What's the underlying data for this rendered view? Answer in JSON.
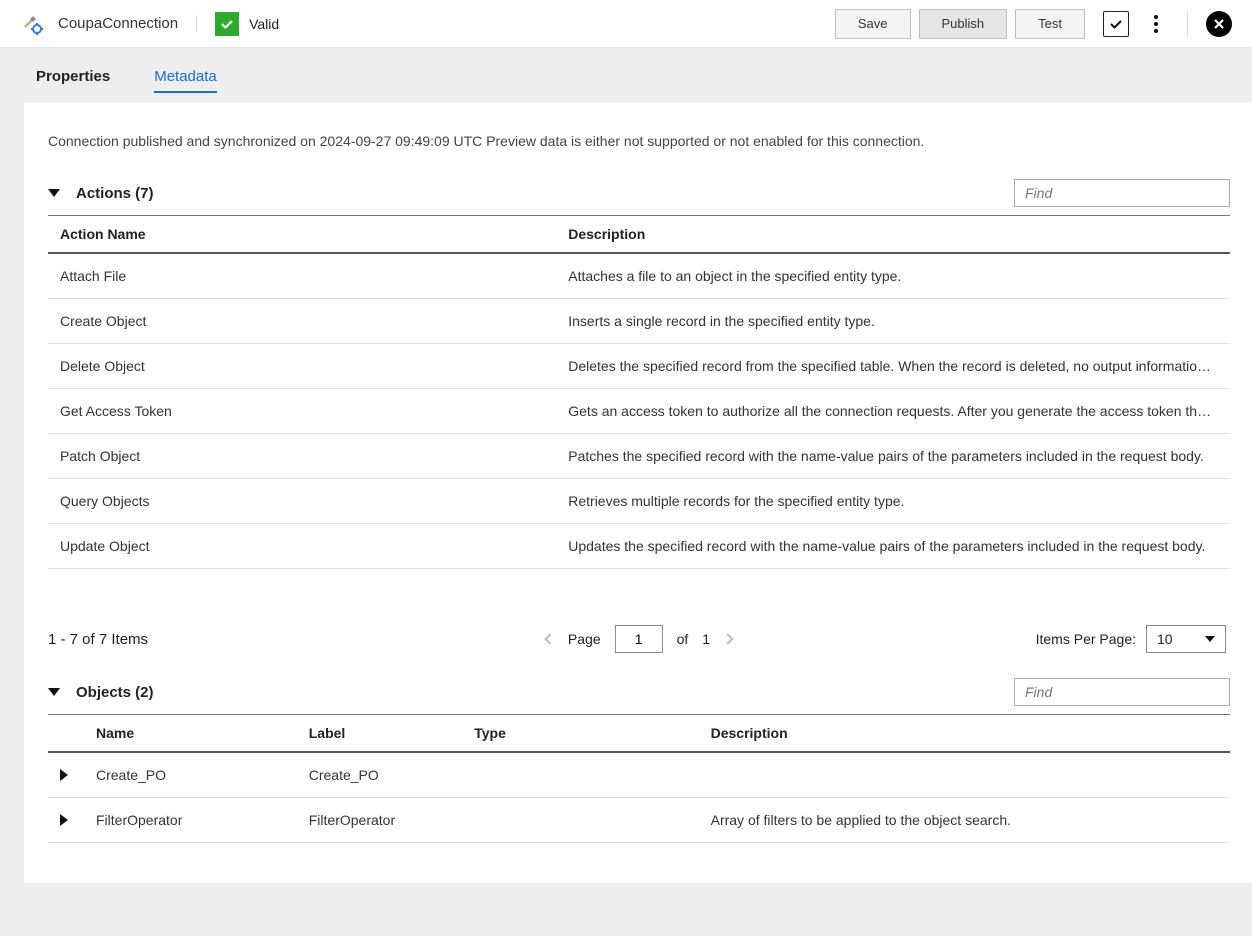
{
  "header": {
    "title": "CoupaConnection",
    "status_label": "Valid",
    "save_label": "Save",
    "publish_label": "Publish",
    "test_label": "Test"
  },
  "tabs": {
    "properties_label": "Properties",
    "metadata_label": "Metadata"
  },
  "status_text": "Connection published and synchronized on 2024-09-27 09:49:09 UTC Preview data is either not supported or not enabled for this connection.",
  "actions_section": {
    "title": "Actions (7)",
    "find_placeholder": "Find",
    "columns": {
      "name": "Action Name",
      "description": "Description"
    },
    "rows": [
      {
        "name": "Attach File",
        "description": "Attaches a file to an object in the specified entity type."
      },
      {
        "name": "Create Object",
        "description": "Inserts a single record in the specified entity type."
      },
      {
        "name": "Delete Object",
        "description": "Deletes the specified record from the specified table. When the record is deleted, no output information is..."
      },
      {
        "name": "Get Access Token",
        "description": "Gets an access token to authorize all the connection requests. After you generate the access token the fir..."
      },
      {
        "name": "Patch Object",
        "description": "Patches the specified record with the name-value pairs of the parameters included in the request body."
      },
      {
        "name": "Query Objects",
        "description": "Retrieves multiple records for the specified entity type."
      },
      {
        "name": "Update Object",
        "description": "Updates the specified record with the name-value pairs of the parameters included in the request body."
      }
    ]
  },
  "pager": {
    "count_label": "1 - 7 of 7 Items",
    "page_label": "Page",
    "page_value": "1",
    "of_label": "of",
    "total_pages": "1",
    "items_per_page_label": "Items Per Page:",
    "items_per_page_value": "10"
  },
  "objects_section": {
    "title": "Objects (2)",
    "find_placeholder": "Find",
    "columns": {
      "name": "Name",
      "label": "Label",
      "type": "Type",
      "description": "Description"
    },
    "rows": [
      {
        "name": "Create_PO",
        "label": "Create_PO",
        "type": "",
        "description": ""
      },
      {
        "name": "FilterOperator",
        "label": "FilterOperator",
        "type": "",
        "description": "Array of filters to be applied to the object search."
      }
    ]
  }
}
